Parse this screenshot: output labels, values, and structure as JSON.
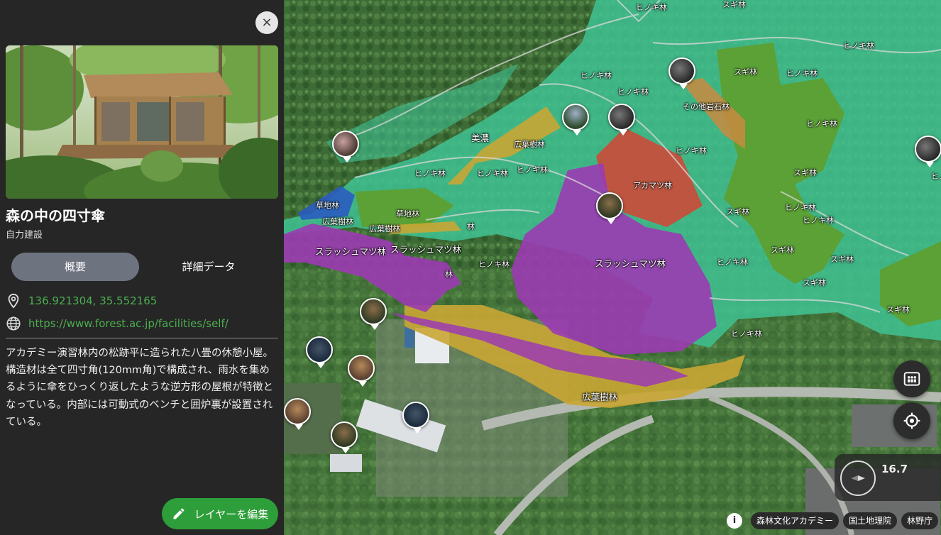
{
  "panel": {
    "close_label": "×",
    "title": "森の中の四寸傘",
    "subtitle": "自力建設",
    "tabs": {
      "overview": "概要",
      "detail": "詳細データ"
    },
    "coordinates": "136.921304, 35.552165",
    "url": "https://www.forest.ac.jp/facilities/self/",
    "description": "アカデミー演習林内の松跡平に造られた八畳の休憩小屋。構造材は全て四寸角(120mm角)で構成され、雨水を集めるように傘をひっくり返したような逆方形の屋根が特徴となっている。内部には可動式のベンチと囲炉裏が設置されている。",
    "edit_button": "レイヤーを編集",
    "icons": {
      "location": "map-pin-icon",
      "web": "globe-icon",
      "edit": "pencil-icon",
      "close": "close-icon"
    }
  },
  "map": {
    "labels": {
      "l1": "ヒノキ林",
      "l2": "スギ林",
      "l3": "ヒノキ林",
      "l4": "ヒノキ林",
      "l5": "ヒノキ林",
      "l6": "スギ林",
      "l7": "ヒノキ林",
      "l8": "その他岩石林",
      "l9": "ヒノキ林",
      "l10": "美濃",
      "l11": "広葉樹林",
      "l12": "ヒノキ林",
      "l13": "ヒノキ林",
      "l14": "ヒノキ林",
      "l15": "ヒノキ林",
      "l16": "スギ林",
      "l17": "アカマツ林",
      "l18": "草地林",
      "l19": "草地林",
      "l20": "スギ林",
      "l21": "ヒノキ林",
      "l22": "ヒノキ林",
      "l23": "広葉樹林",
      "l24": "広葉樹林",
      "l25": "林",
      "l26": "スラッシュマツ林",
      "l27": "スラッシュマツ林",
      "l28": "スラッシュマツ林",
      "l29": "ヒノキ林",
      "l30": "ヒノキ林",
      "l31": "スギ林",
      "l32": "スギ林",
      "l33": "林",
      "l34": "スギ林",
      "l35": "ヒノキ林",
      "l36": "スギ林",
      "l37": "広葉樹林",
      "l38": "ヒノ"
    },
    "zoom": "16.7",
    "attribution": [
      "森林文化アカデミー",
      "国土地理院",
      "林野庁"
    ],
    "info_label": "i",
    "colors": {
      "hinoki": "#3fc293",
      "sugi": "#5e9e2e",
      "slash_pine": "#9b3bb3",
      "broadleaf": "#c9a634",
      "akamatsu": "#cc4a3a",
      "grassland": "#2a5cc0",
      "accent_green": "#4caf50"
    }
  }
}
